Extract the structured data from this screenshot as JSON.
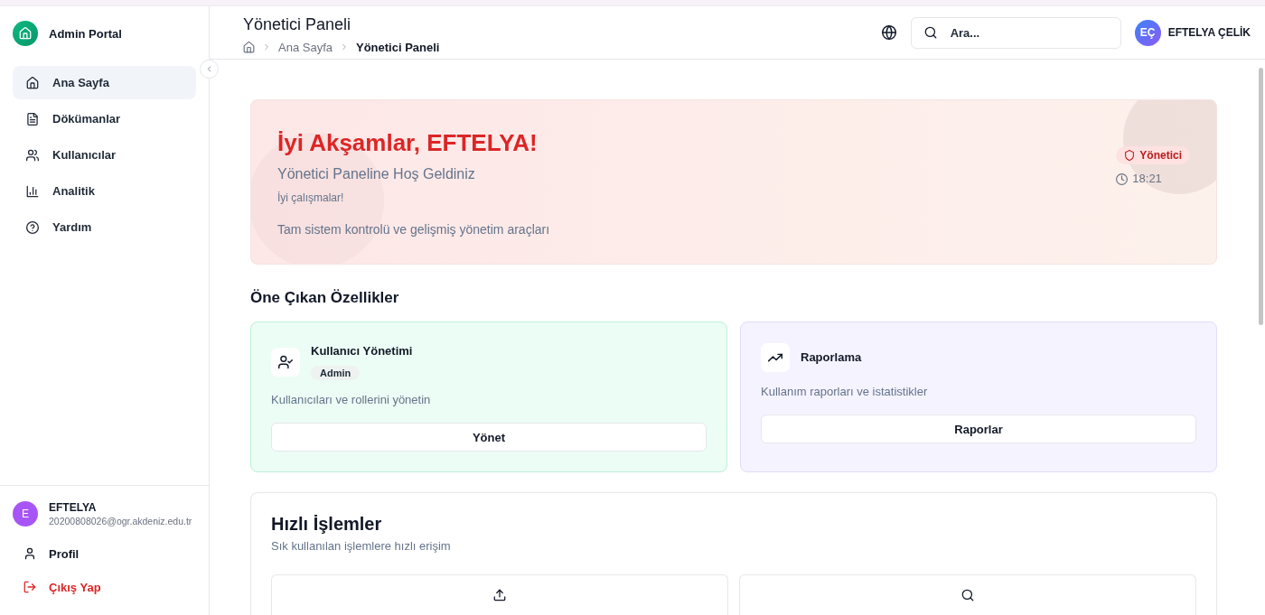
{
  "sidebar": {
    "brand": "Admin Portal",
    "nav_items": [
      {
        "kind": "home",
        "label": "Ana Sayfa",
        "selected": true
      },
      {
        "kind": "document",
        "label": "Dökümanlar",
        "selected": false
      },
      {
        "kind": "users",
        "label": "Kullanıcılar",
        "selected": false
      },
      {
        "kind": "chart",
        "label": "Analitik",
        "selected": false
      },
      {
        "kind": "help",
        "label": "Yardım",
        "selected": false
      }
    ],
    "user": {
      "avatar_initial": "E",
      "name": "EFTELYA",
      "email": "20200808026@ogr.akdeniz.edu.tr"
    },
    "bottom_items": [
      {
        "kind": "profile",
        "label": "Profil"
      },
      {
        "kind": "logout",
        "label": "Çıkış Yap"
      }
    ]
  },
  "header": {
    "title": "Yönetici Paneli",
    "breadcrumb": [
      {
        "label": "Ana Sayfa",
        "current": false
      },
      {
        "label": "Yönetici Paneli",
        "current": true
      }
    ],
    "search": {
      "placeholder": "Ara..."
    },
    "user": {
      "initials": "EÇ",
      "name": "EFTELYA ÇELİK"
    }
  },
  "hero": {
    "greeting": "İyi Akşamlar, EFTELYA!",
    "subtitle": "Yönetici Paneline Hoş Geldiniz",
    "note": "İyi çalışmalar!",
    "description": "Tam sistem kontrolü ve gelişmiş yönetim araçları",
    "role_badge": "Yönetici",
    "time": "18:21"
  },
  "featured": {
    "title": "Öne Çıkan Özellikler",
    "cards": [
      {
        "kind": "users",
        "title": "Kullanıcı Yönetimi",
        "badge": "Admin",
        "description": "Kullanıcıları ve rollerini yönetin",
        "button": "Yönet"
      },
      {
        "kind": "reports",
        "title": "Raporlama",
        "description": "Kullanım raporları ve istatistikler",
        "button": "Raporlar"
      }
    ]
  },
  "quick_actions": {
    "title": "Hızlı İşlemler",
    "subtitle": "Sık kullanılan işlemlere hızlı erişim",
    "buttons": [
      {
        "kind": "upload"
      },
      {
        "kind": "search"
      }
    ]
  }
}
